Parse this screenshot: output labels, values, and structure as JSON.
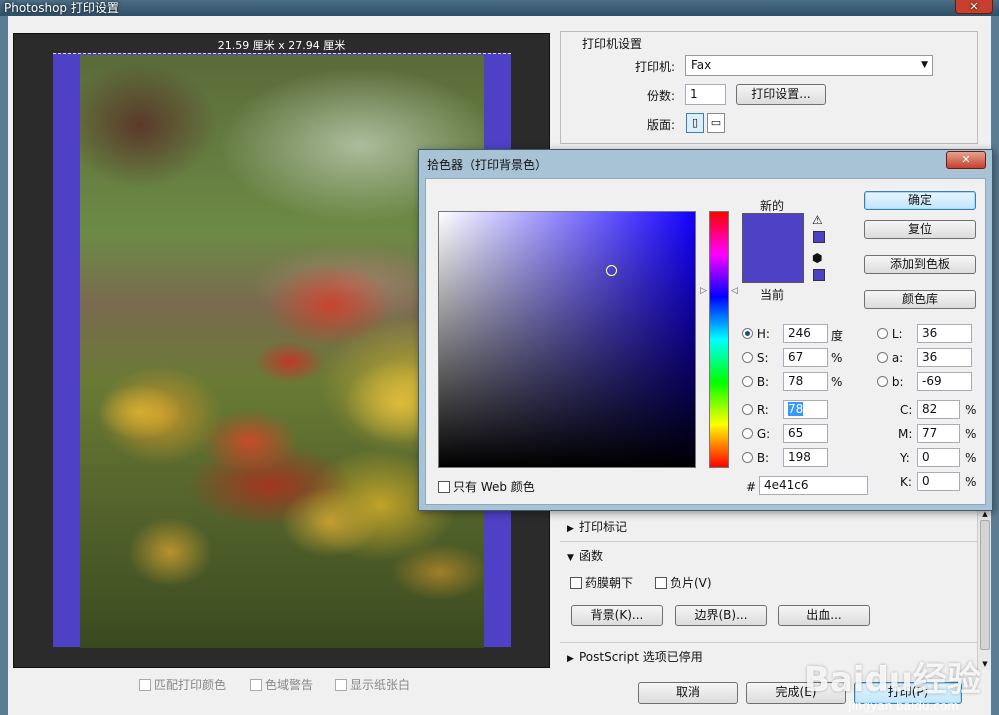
{
  "window": {
    "title": "Photoshop 打印设置"
  },
  "preview": {
    "dimensions": "21.59 厘米 x 27.94 厘米",
    "background_color": "#4e41c6"
  },
  "preview_options": {
    "match_print_colors": "匹配打印颜色",
    "gamut_warning": "色域警告",
    "show_paper_white": "显示纸张白"
  },
  "printer_setup": {
    "heading": "打印机设置",
    "printer_label": "打印机:",
    "printer_value": "Fax",
    "copies_label": "份数:",
    "copies_value": "1",
    "print_settings_button": "打印设置...",
    "layout_label": "版面:"
  },
  "sections": {
    "print_marks": "打印标记",
    "functions": "函数",
    "emulsion_down": "药膜朝下",
    "negative": "负片(V)",
    "background_button": "背景(K)...",
    "border_button": "边界(B)...",
    "bleed_button": "出血...",
    "postscript": "PostScript 选项已停用"
  },
  "footer": {
    "cancel": "取消",
    "done": "完成(E)",
    "print": "打印(P)"
  },
  "watermark": {
    "logo": "Baidu经验",
    "url": "jingyan.baidu.com"
  },
  "color_picker": {
    "title": "拾色器（打印背景色）",
    "new_label": "新的",
    "current_label": "当前",
    "ok": "确定",
    "reset": "复位",
    "add_to_swatches": "添加到色板",
    "color_libraries": "颜色库",
    "only_web_colors": "只有 Web 颜色",
    "hsb": {
      "h_label": "H:",
      "h_value": "246",
      "h_unit": "度",
      "s_label": "S:",
      "s_value": "67",
      "s_unit": "%",
      "b_label": "B:",
      "b_value": "78",
      "b_unit": "%"
    },
    "rgb": {
      "r_label": "R:",
      "r_value": "78",
      "g_label": "G:",
      "g_value": "65",
      "b_label": "B:",
      "b_value": "198"
    },
    "lab": {
      "l_label": "L:",
      "l_value": "36",
      "a_label": "a:",
      "a_value": "36",
      "b_label": "b:",
      "b_value": "-69"
    },
    "cmyk": {
      "c_label": "C:",
      "c_value": "82",
      "m_label": "M:",
      "m_value": "77",
      "y_label": "Y:",
      "y_value": "0",
      "k_label": "K:",
      "k_value": "0",
      "unit": "%"
    },
    "hex_label": "#",
    "hex_value": "4e41c6",
    "selected_color": "#4e41c6"
  }
}
